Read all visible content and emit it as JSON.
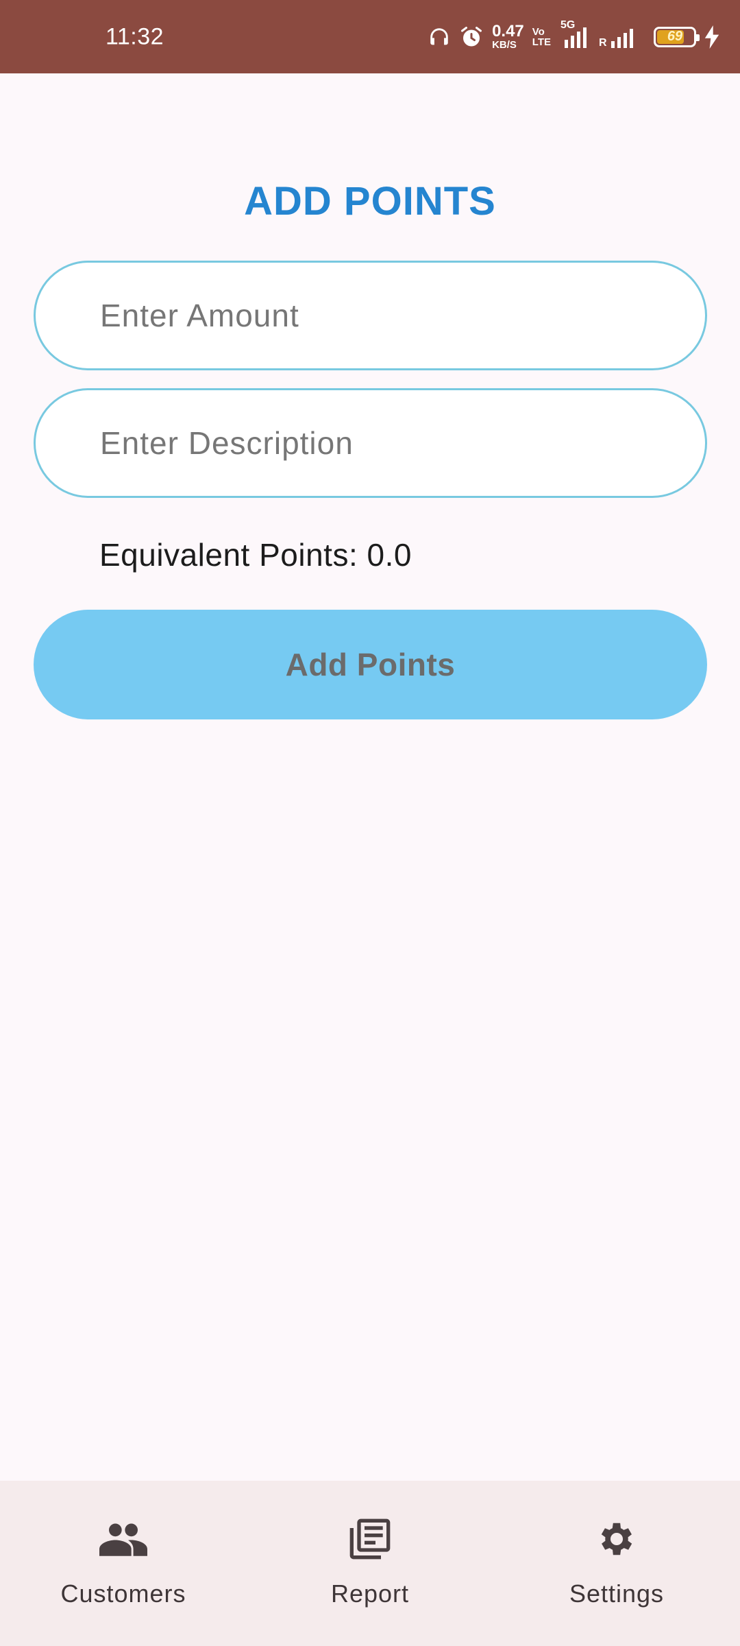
{
  "status_bar": {
    "time": "11:32",
    "net_speed_value": "0.47",
    "net_speed_unit": "KB/S",
    "volte_top": "Vo",
    "volte_bottom": "LTE",
    "network_5g": "5G",
    "roaming": "R",
    "battery_level": "69",
    "battery_fraction": 0.69,
    "icons": [
      "headphones-icon",
      "alarm-icon",
      "signal-5g-icon",
      "signal-icon",
      "battery-icon",
      "charging-icon"
    ]
  },
  "screen": {
    "title": "ADD POINTS",
    "amount_placeholder": "Enter Amount",
    "amount_value": "",
    "description_placeholder": "Enter Description",
    "description_value": "",
    "equivalent_points": "Equivalent Points: 0.0",
    "submit_label": "Add Points"
  },
  "bottom_nav": {
    "items": [
      {
        "label": "Customers",
        "icon": "people-icon"
      },
      {
        "label": "Report",
        "icon": "report-icon"
      },
      {
        "label": "Settings",
        "icon": "gear-icon"
      }
    ]
  },
  "colors": {
    "status_bar": "#8b4a40",
    "title": "#2585d0",
    "field_border": "#78c9e0",
    "button": "#76caf2",
    "nav_background": "#f5ebec",
    "page_background": "#fdf8fb"
  }
}
